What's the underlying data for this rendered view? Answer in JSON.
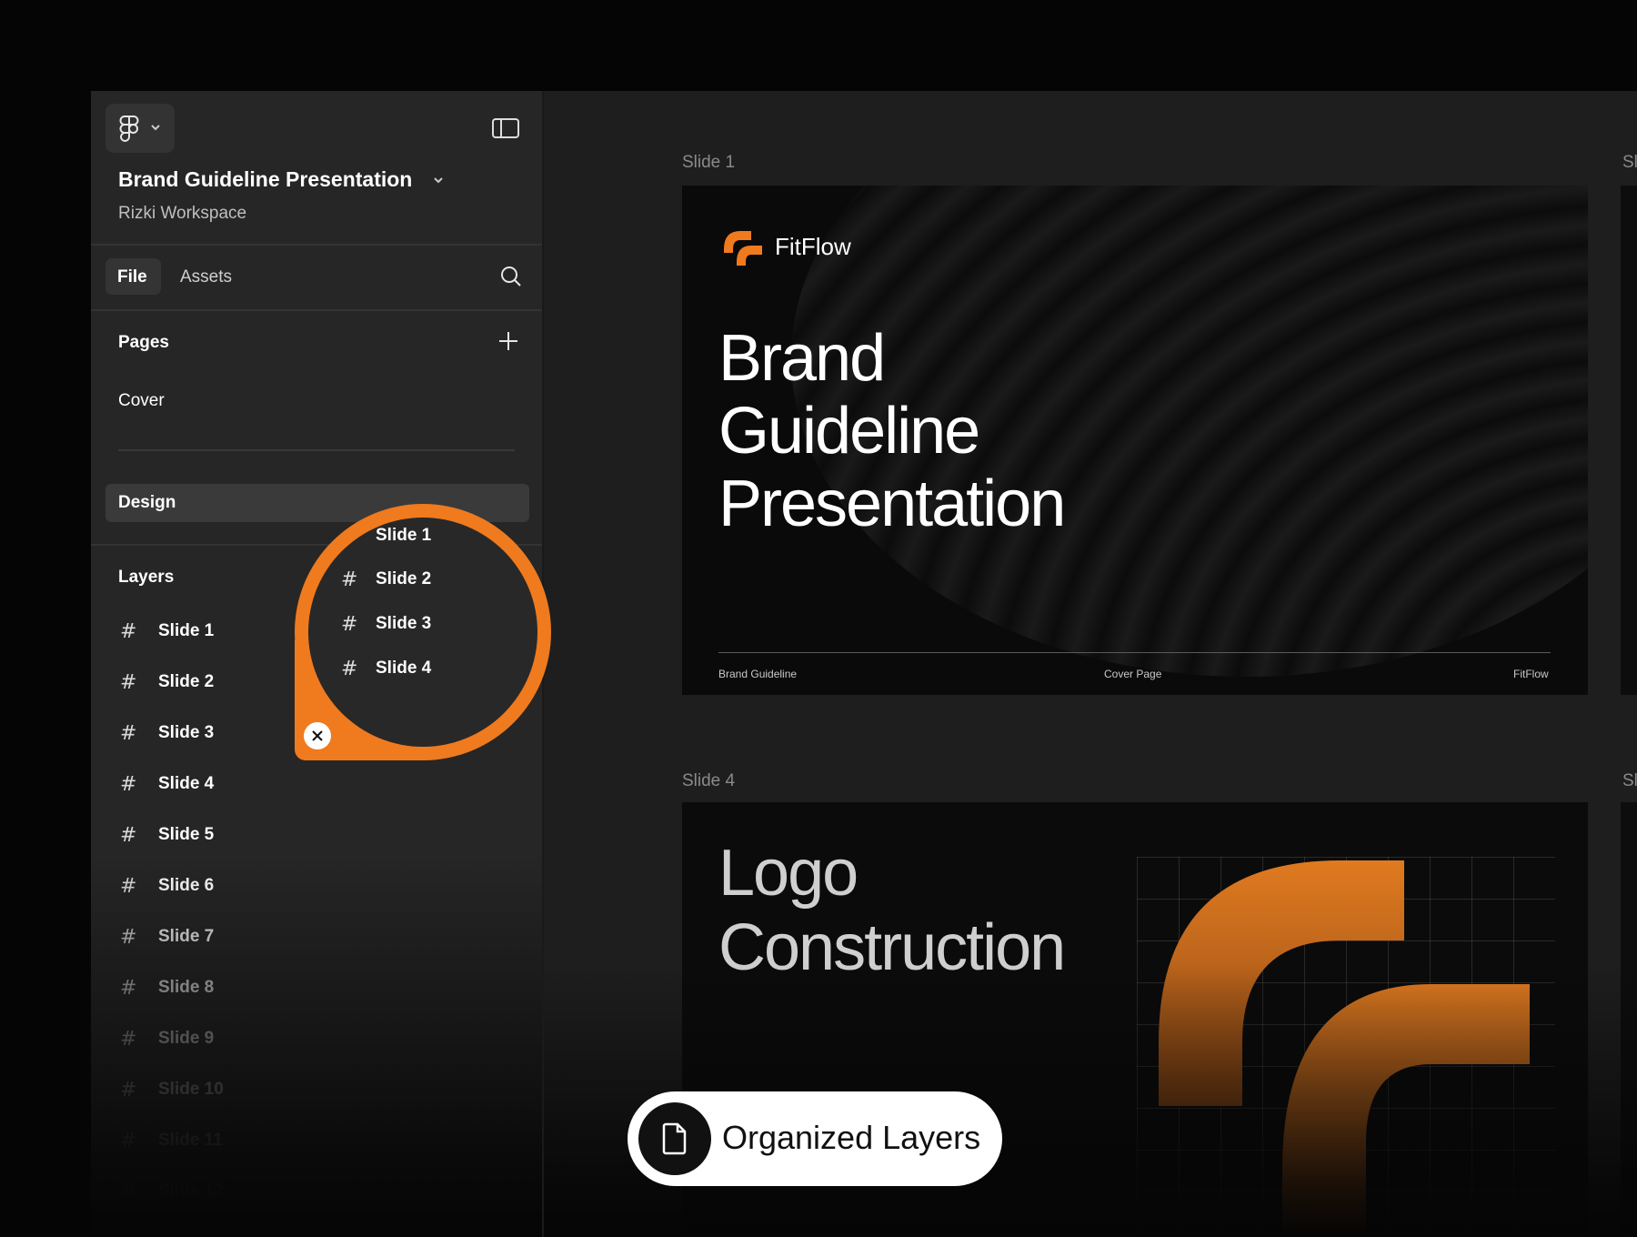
{
  "file": {
    "title": "Brand Guideline Presentation",
    "workspace": "Rizki Workspace"
  },
  "tabs": [
    {
      "label": "File",
      "active": true
    },
    {
      "label": "Assets",
      "active": false
    }
  ],
  "pages": {
    "heading": "Pages",
    "items": [
      {
        "label": "Cover",
        "selected": false
      },
      {
        "label": "Design",
        "selected": true
      }
    ]
  },
  "layers": {
    "heading": "Layers",
    "items": [
      "Slide 1",
      "Slide 2",
      "Slide 3",
      "Slide 4",
      "Slide 5",
      "Slide 6",
      "Slide 7",
      "Slide 8",
      "Slide 9",
      "Slide 10",
      "Slide 11",
      "Slide 12"
    ]
  },
  "callout": {
    "items": [
      "Slide 1",
      "Slide 2",
      "Slide 3",
      "Slide 4"
    ],
    "accent": "#f07a1e"
  },
  "canvas": {
    "slide1": {
      "label": "Slide 1",
      "brand": "FitFlow",
      "title_lines": [
        "Brand",
        "Guideline",
        "Presentation"
      ],
      "footer": [
        "Brand Guideline",
        "Cover Page",
        "FitFlow"
      ]
    },
    "slide4": {
      "label": "Slide 4",
      "title_lines": [
        "Logo",
        "Construction"
      ]
    }
  },
  "badge": {
    "label": "Organized Layers",
    "icon": "document-icon"
  },
  "colors": {
    "accent": "#f07a1e",
    "sidebar_bg": "#262626",
    "canvas_bg": "#1e1e1e"
  }
}
